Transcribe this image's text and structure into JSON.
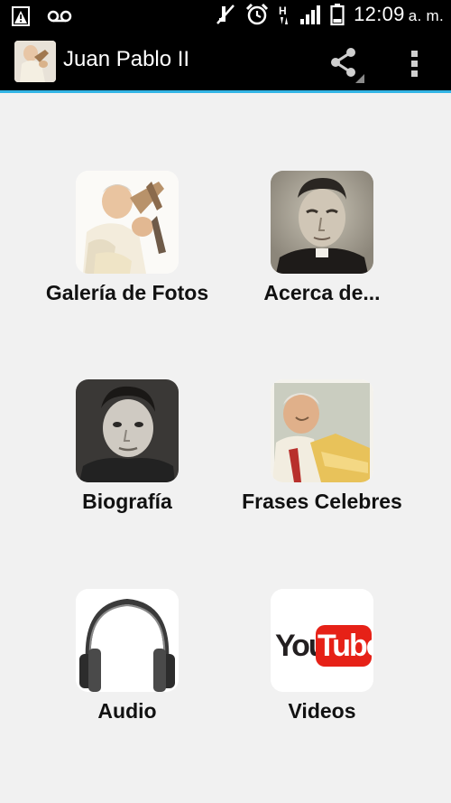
{
  "status_bar": {
    "time": "12:09",
    "time_suffix": "a. m.",
    "icons": [
      "warning-icon",
      "voicemail-icon",
      "mute-icon",
      "alarm-icon",
      "h-network-icon",
      "signal-icon",
      "battery-icon"
    ]
  },
  "action_bar": {
    "title": "Juan Pablo II",
    "icons": [
      "app-icon",
      "share-icon",
      "overflow-menu-icon"
    ],
    "accent_color": "#33b5e5"
  },
  "tiles": [
    {
      "label": "Galería de Fotos",
      "icon": "pope-praying-photo"
    },
    {
      "label": "Acerca de...",
      "icon": "young-priest-portrait"
    },
    {
      "label": "Biografía",
      "icon": "child-portrait"
    },
    {
      "label": "Frases Celebres",
      "icon": "pope-smiling-photo"
    },
    {
      "label": "Audio",
      "icon": "headphones-icon"
    },
    {
      "label": "Videos",
      "icon": "youtube-logo"
    }
  ],
  "youtube_logo": {
    "you": "You",
    "tube": "Tube"
  }
}
